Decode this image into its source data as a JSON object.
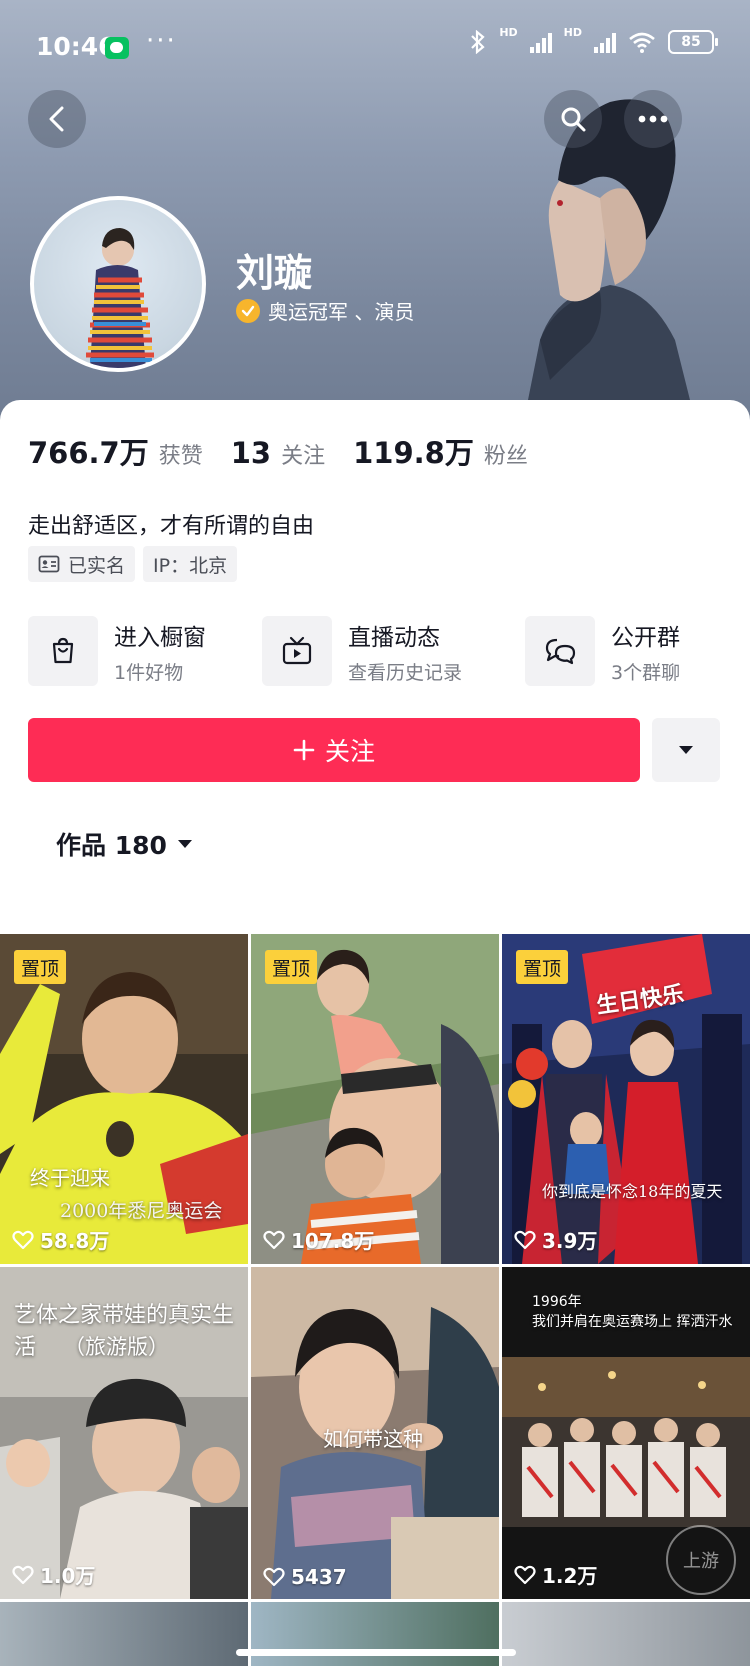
{
  "status_bar": {
    "time": "10:46",
    "battery": "85"
  },
  "profile": {
    "name": "刘璇",
    "verified_label": "奥运冠军 、演员",
    "stats": [
      {
        "value": "766.7万",
        "label": "获赞"
      },
      {
        "value": "13",
        "label": "关注"
      },
      {
        "value": "119.8万",
        "label": "粉丝"
      }
    ],
    "bio": "走出舒适区，才有所谓的自由",
    "tags": {
      "real_name": "已实名",
      "ip": "IP：北京"
    }
  },
  "features": [
    {
      "title": "进入橱窗",
      "subtitle": "1件好物",
      "icon": "shopping-bag-icon"
    },
    {
      "title": "直播动态",
      "subtitle": "查看历史记录",
      "icon": "tv-icon"
    },
    {
      "title": "公开群",
      "subtitle": "3个群聊",
      "icon": "chat-bubbles-icon"
    }
  ],
  "follow_button": {
    "label": "关注"
  },
  "works_tab": {
    "label": "作品 180"
  },
  "pinned_label": "置顶",
  "videos": [
    {
      "likes": "58.8万",
      "pinned": true,
      "captions": [
        "终于迎来",
        "2000年悉尼奥运会"
      ]
    },
    {
      "likes": "107.8万",
      "pinned": true,
      "captions": []
    },
    {
      "likes": "3.9万",
      "pinned": true,
      "captions": [
        "你到底是怀念18年的夏天",
        "生日快乐"
      ]
    },
    {
      "likes": "1.0万",
      "pinned": false,
      "captions": [
        "艺体之家带娃的真实生活",
        "（旅游版）"
      ]
    },
    {
      "likes": "5437",
      "pinned": false,
      "captions": [
        "如何带这种"
      ]
    },
    {
      "likes": "1.2万",
      "pinned": false,
      "captions": [
        "1996年",
        "我们并肩在奥运赛场上 挥洒汗水"
      ]
    }
  ],
  "watermark": "上游"
}
